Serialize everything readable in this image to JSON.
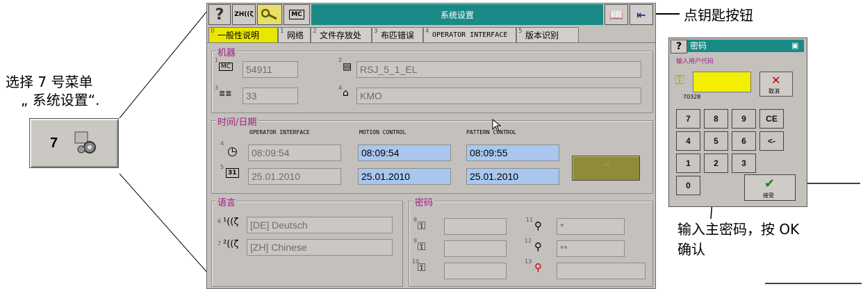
{
  "annotations": {
    "left_line1": "选择 7 号菜单",
    "left_line2": "„ 系统设置“.",
    "key_label": "点钥匙按钮",
    "enter_pw_line1": "输入主密码，按 OK",
    "enter_pw_line2": "确认"
  },
  "menu_button": {
    "number": "7"
  },
  "window": {
    "title": "系统设置",
    "tabs": [
      {
        "num": "0",
        "label": "一般性说明"
      },
      {
        "num": "1",
        "label": "网络"
      },
      {
        "num": "2",
        "label": "文件存放处"
      },
      {
        "num": "3",
        "label": "布匹错误"
      },
      {
        "num": "4",
        "label": "OPERATOR INTERFACE"
      },
      {
        "num": "5",
        "label": "版本识别"
      }
    ],
    "machine": {
      "title": "机器",
      "n1": "1",
      "n2": "2",
      "n3": "3",
      "n4": "4",
      "f1": "54911",
      "f2": "RSJ_5_1_EL",
      "f3": "33",
      "f4": "KMO",
      "mc_icon": "MC"
    },
    "datetime": {
      "title": "时间/日期",
      "h1": "OPERATOR INTERFACE",
      "h2": "MOTION CONTROL",
      "h3": "PATTERN CONTROL",
      "n4": "4",
      "n5": "5",
      "t1": "08:09:54",
      "t2": "08:09:54",
      "t3": "08:09:55",
      "d1": "25.01.2010",
      "d2": "25.01.2010",
      "d3": "25.01.2010",
      "cal_icon": "31"
    },
    "language": {
      "title": "语言",
      "n6": "6",
      "n7": "7",
      "l1": "[DE] Deutsch",
      "l2": "[ZH] Chinese"
    },
    "password": {
      "title": "密码",
      "n8": "8",
      "n9": "9",
      "n10": "10",
      "n11": "11",
      "n12": "12",
      "n13": "13",
      "p11": "*",
      "p12": "**"
    }
  },
  "pw_dialog": {
    "title": "密码",
    "prompt": "输入用户代码",
    "code": "70328",
    "cancel": "取消",
    "ok": "接受",
    "keys": [
      "7",
      "8",
      "9",
      "CE",
      "4",
      "5",
      "6",
      "<-",
      "1",
      "2",
      "3",
      "0"
    ]
  },
  "colors": {
    "teal": "#1a8a86",
    "purple": "#a0208a",
    "yellow": "#e9e600",
    "blue_field": "#a9c7ee"
  }
}
